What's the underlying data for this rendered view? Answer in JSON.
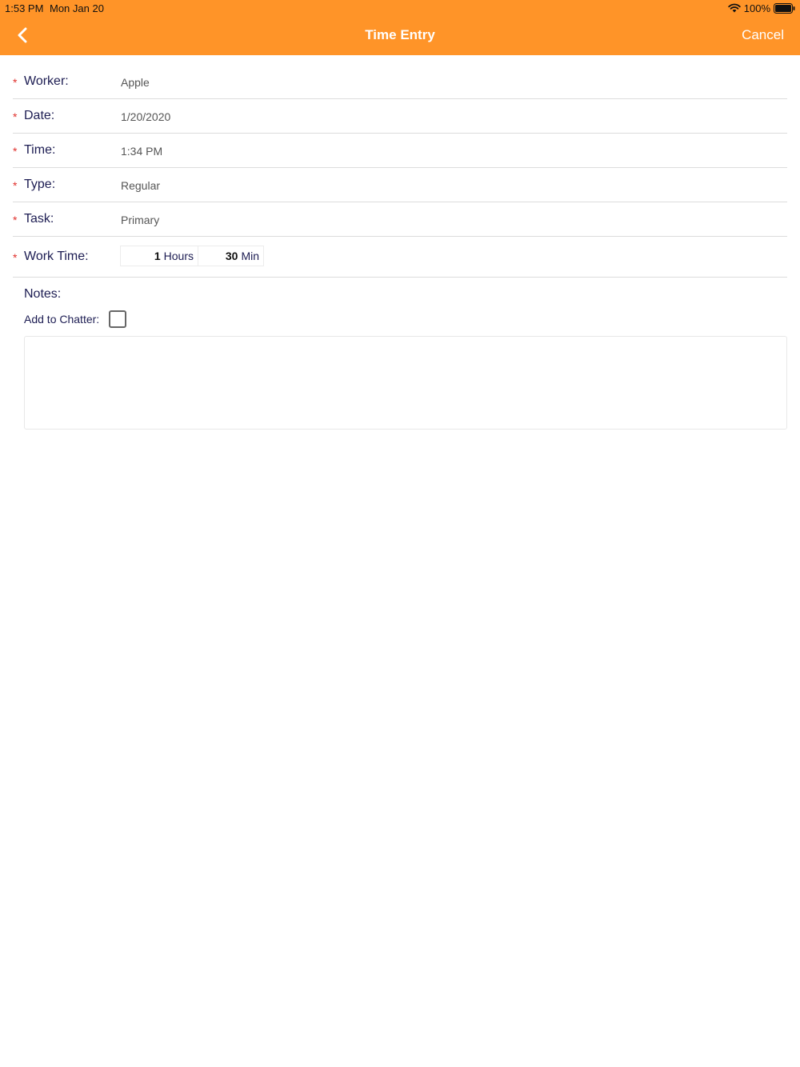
{
  "status_bar": {
    "time": "1:53 PM",
    "date": "Mon Jan 20",
    "battery": "100%",
    "icons": [
      "wifi-icon",
      "battery-icon"
    ]
  },
  "nav": {
    "title": "Time Entry",
    "back_icon": "chevron-left-icon",
    "cancel_label": "Cancel"
  },
  "colors": {
    "nav_bg": "#ff9428",
    "label": "#1c1c52",
    "required": "#e0302c"
  },
  "required_marker": "*",
  "fields": [
    {
      "label": "Worker:",
      "value": "Apple"
    },
    {
      "label": "Date:",
      "value": "1/20/2020"
    },
    {
      "label": "Time:",
      "value": "1:34 PM"
    },
    {
      "label": "Type:",
      "value": "Regular"
    },
    {
      "label": "Task:",
      "value": "Primary"
    }
  ],
  "work_time": {
    "label": "Work Time:",
    "hours_value": "1",
    "hours_unit": "Hours",
    "minutes_value": "30",
    "minutes_unit": "Min"
  },
  "notes": {
    "label": "Notes:",
    "chatter_label": "Add to Chatter:",
    "chatter_checked": false,
    "text": ""
  }
}
